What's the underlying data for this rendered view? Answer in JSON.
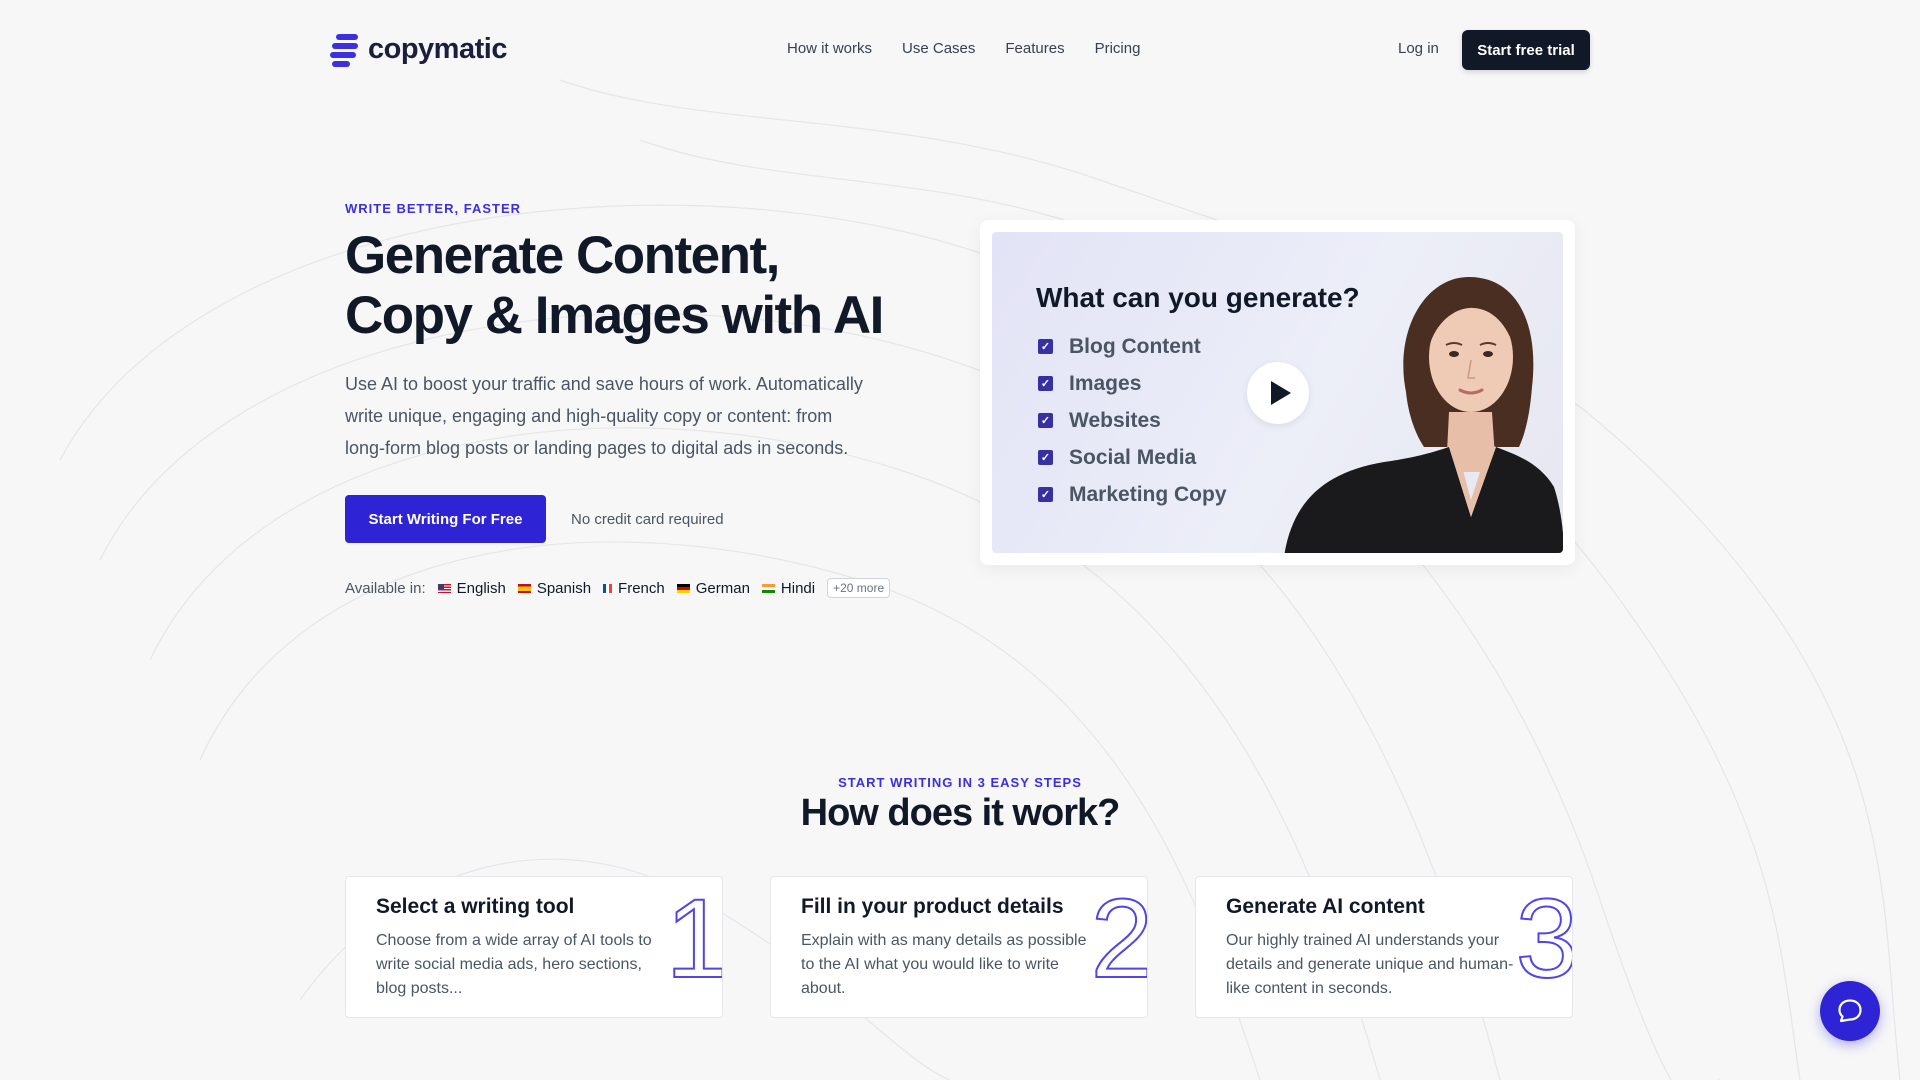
{
  "brand": {
    "name": "copymatic",
    "accent": "#2e24d6"
  },
  "nav": {
    "links": [
      "How it works",
      "Use Cases",
      "Features",
      "Pricing"
    ],
    "login": "Log in",
    "trial": "Start free trial"
  },
  "hero": {
    "eyebrow": "WRITE BETTER, FASTER",
    "title_line1": "Generate Content,",
    "title_line2": "Copy & Images with AI",
    "subtitle": "Use AI to boost your traffic and save hours of work. Automatically write unique, engaging and high-quality copy or content: from long-form blog posts or landing pages to digital ads in seconds.",
    "cta": "Start Writing For Free",
    "no_cc": "No credit card required",
    "available_label": "Available in:",
    "languages": [
      "English",
      "Spanish",
      "French",
      "German",
      "Hindi"
    ],
    "more": "+20 more"
  },
  "video": {
    "title": "What can you generate?",
    "items": [
      "Blog Content",
      "Images",
      "Websites",
      "Social Media",
      "Marketing Copy"
    ],
    "play_icon": "play-icon"
  },
  "how": {
    "eyebrow": "START WRITING IN 3 EASY STEPS",
    "title": "How does it work?",
    "steps": [
      {
        "title": "Select a writing tool",
        "text": "Choose from a wide array of AI tools to write social media ads, hero sections, blog posts...",
        "num": "1"
      },
      {
        "title": "Fill in your product details",
        "text": "Explain with as many details as possible to the AI what you would like to write about.",
        "num": "2"
      },
      {
        "title": "Generate AI content",
        "text": "Our highly trained AI understands your details and generate unique and human-like content in seconds.",
        "num": "3"
      }
    ]
  },
  "chat": {
    "icon": "chat-bubble-icon"
  }
}
